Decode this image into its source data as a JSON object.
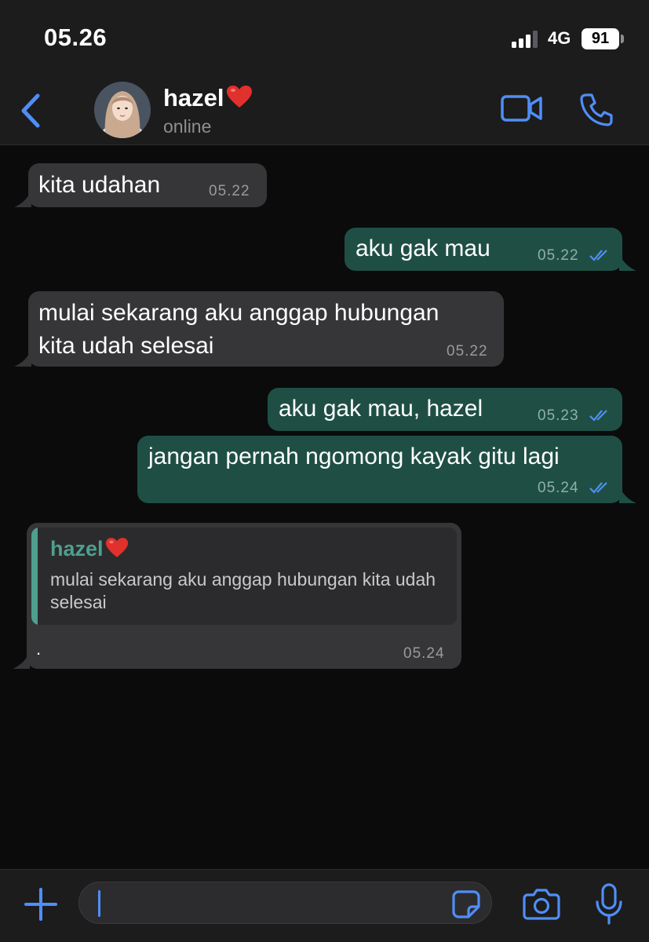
{
  "status_bar": {
    "time": "05.26",
    "network": "4G",
    "battery": "91"
  },
  "header": {
    "contact_name": "hazel",
    "contact_status": "online",
    "icons": [
      "back-icon",
      "avatar",
      "heart-icon",
      "video-call-icon",
      "voice-call-icon"
    ]
  },
  "colors": {
    "accent": "#4f8ef7",
    "incoming_bubble": "#363638",
    "outgoing_bubble": "#1f4f44",
    "quote_author": "#4f9f8e",
    "background": "#0b0b0b"
  },
  "messages": [
    {
      "direction": "in",
      "text": "kita udahan",
      "time": "05.22"
    },
    {
      "direction": "out",
      "text": "aku gak mau",
      "time": "05.22",
      "read": true
    },
    {
      "direction": "in",
      "text_lines": [
        "mulai sekarang aku anggap hubungan",
        "kita udah selesai"
      ],
      "time": "05.22"
    },
    {
      "direction": "out",
      "text": "aku gak mau, hazel",
      "time": "05.23",
      "read": true
    },
    {
      "direction": "out",
      "text": "jangan pernah ngomong kayak gitu lagi",
      "time": "05.24",
      "read": true
    },
    {
      "direction": "in",
      "quote": {
        "author": "hazel",
        "text": "mulai sekarang aku anggap hubungan kita udah selesai"
      },
      "text": ".",
      "time": "05.24"
    }
  ],
  "input_bar": {
    "value": "",
    "icons": [
      "plus-icon",
      "sticker-icon",
      "camera-icon",
      "microphone-icon"
    ]
  }
}
